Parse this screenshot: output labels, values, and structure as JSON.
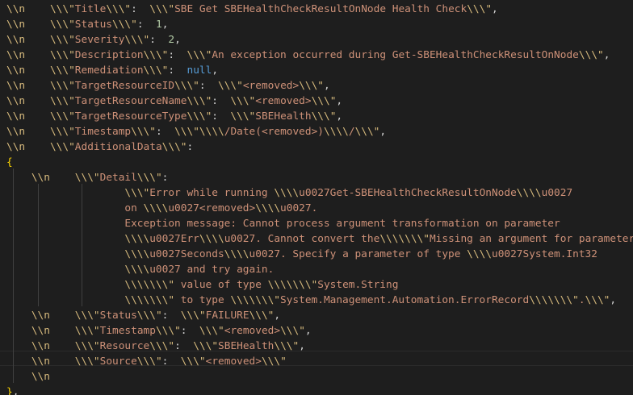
{
  "colors": {
    "background": "#1e1e1e",
    "escape": "#d7ba7d",
    "string": "#ce9178",
    "number": "#b5cea8",
    "keyword": "#569cd6",
    "text": "#d4d4d4",
    "brace": "#ffd700",
    "indent_guide": "#404040"
  },
  "lines": [
    [
      {
        "t": "esc",
        "v": "\\\\n"
      },
      {
        "t": "txt",
        "v": "    "
      },
      {
        "t": "esc",
        "v": "\\\\\\\""
      },
      {
        "t": "str",
        "v": "Title"
      },
      {
        "t": "esc",
        "v": "\\\\\\\""
      },
      {
        "t": "txt",
        "v": ":  "
      },
      {
        "t": "esc",
        "v": "\\\\\\\""
      },
      {
        "t": "str",
        "v": "SBE Get SBEHealthCheckResultOnNode Health Check"
      },
      {
        "t": "esc",
        "v": "\\\\\\\""
      },
      {
        "t": "txt",
        "v": ","
      }
    ],
    [
      {
        "t": "esc",
        "v": "\\\\n"
      },
      {
        "t": "txt",
        "v": "    "
      },
      {
        "t": "esc",
        "v": "\\\\\\\""
      },
      {
        "t": "str",
        "v": "Status"
      },
      {
        "t": "esc",
        "v": "\\\\\\\""
      },
      {
        "t": "txt",
        "v": ":  "
      },
      {
        "t": "num",
        "v": "1"
      },
      {
        "t": "txt",
        "v": ","
      }
    ],
    [
      {
        "t": "esc",
        "v": "\\\\n"
      },
      {
        "t": "txt",
        "v": "    "
      },
      {
        "t": "esc",
        "v": "\\\\\\\""
      },
      {
        "t": "str",
        "v": "Severity"
      },
      {
        "t": "esc",
        "v": "\\\\\\\""
      },
      {
        "t": "txt",
        "v": ":  "
      },
      {
        "t": "num",
        "v": "2"
      },
      {
        "t": "txt",
        "v": ","
      }
    ],
    [
      {
        "t": "esc",
        "v": "\\\\n"
      },
      {
        "t": "txt",
        "v": "    "
      },
      {
        "t": "esc",
        "v": "\\\\\\\""
      },
      {
        "t": "str",
        "v": "Description"
      },
      {
        "t": "esc",
        "v": "\\\\\\\""
      },
      {
        "t": "txt",
        "v": ":  "
      },
      {
        "t": "esc",
        "v": "\\\\\\\""
      },
      {
        "t": "str",
        "v": "An exception occurred during Get-SBEHealthCheckResultOnNode"
      },
      {
        "t": "esc",
        "v": "\\\\\\\""
      },
      {
        "t": "txt",
        "v": ","
      }
    ],
    [
      {
        "t": "esc",
        "v": "\\\\n"
      },
      {
        "t": "txt",
        "v": "    "
      },
      {
        "t": "esc",
        "v": "\\\\\\\""
      },
      {
        "t": "str",
        "v": "Remediation"
      },
      {
        "t": "esc",
        "v": "\\\\\\\""
      },
      {
        "t": "txt",
        "v": ":  "
      },
      {
        "t": "kw",
        "v": "null"
      },
      {
        "t": "txt",
        "v": ","
      }
    ],
    [
      {
        "t": "esc",
        "v": "\\\\n"
      },
      {
        "t": "txt",
        "v": "    "
      },
      {
        "t": "esc",
        "v": "\\\\\\\""
      },
      {
        "t": "str",
        "v": "TargetResourceID"
      },
      {
        "t": "esc",
        "v": "\\\\\\\""
      },
      {
        "t": "txt",
        "v": ":  "
      },
      {
        "t": "esc",
        "v": "\\\\\\\""
      },
      {
        "t": "str",
        "v": "<removed>"
      },
      {
        "t": "esc",
        "v": "\\\\\\\""
      },
      {
        "t": "txt",
        "v": ","
      }
    ],
    [
      {
        "t": "esc",
        "v": "\\\\n"
      },
      {
        "t": "txt",
        "v": "    "
      },
      {
        "t": "esc",
        "v": "\\\\\\\""
      },
      {
        "t": "str",
        "v": "TargetResourceName"
      },
      {
        "t": "esc",
        "v": "\\\\\\\""
      },
      {
        "t": "txt",
        "v": ":  "
      },
      {
        "t": "esc",
        "v": "\\\\\\\""
      },
      {
        "t": "str",
        "v": "<removed>"
      },
      {
        "t": "esc",
        "v": "\\\\\\\""
      },
      {
        "t": "txt",
        "v": ","
      }
    ],
    [
      {
        "t": "esc",
        "v": "\\\\n"
      },
      {
        "t": "txt",
        "v": "    "
      },
      {
        "t": "esc",
        "v": "\\\\\\\""
      },
      {
        "t": "str",
        "v": "TargetResourceType"
      },
      {
        "t": "esc",
        "v": "\\\\\\\""
      },
      {
        "t": "txt",
        "v": ":  "
      },
      {
        "t": "esc",
        "v": "\\\\\\\""
      },
      {
        "t": "str",
        "v": "SBEHealth"
      },
      {
        "t": "esc",
        "v": "\\\\\\\""
      },
      {
        "t": "txt",
        "v": ","
      }
    ],
    [
      {
        "t": "esc",
        "v": "\\\\n"
      },
      {
        "t": "txt",
        "v": "    "
      },
      {
        "t": "esc",
        "v": "\\\\\\\""
      },
      {
        "t": "str",
        "v": "Timestamp"
      },
      {
        "t": "esc",
        "v": "\\\\\\\""
      },
      {
        "t": "txt",
        "v": ":  "
      },
      {
        "t": "esc",
        "v": "\\\\\\\""
      },
      {
        "t": "esc",
        "v": "\\\\\\\\"
      },
      {
        "t": "str",
        "v": "/Date(<removed>)"
      },
      {
        "t": "esc",
        "v": "\\\\\\\\"
      },
      {
        "t": "str",
        "v": "/"
      },
      {
        "t": "esc",
        "v": "\\\\\\\""
      },
      {
        "t": "txt",
        "v": ","
      }
    ],
    [
      {
        "t": "esc",
        "v": "\\\\n"
      },
      {
        "t": "txt",
        "v": "    "
      },
      {
        "t": "esc",
        "v": "\\\\\\\""
      },
      {
        "t": "str",
        "v": "AdditionalData"
      },
      {
        "t": "esc",
        "v": "\\\\\\\""
      },
      {
        "t": "txt",
        "v": ":"
      }
    ],
    [
      {
        "t": "brace",
        "v": "{"
      }
    ],
    [
      {
        "t": "txt",
        "v": "    "
      },
      {
        "t": "esc",
        "v": "\\\\n"
      },
      {
        "t": "txt",
        "v": "    "
      },
      {
        "t": "esc",
        "v": "\\\\\\\""
      },
      {
        "t": "str",
        "v": "Detail"
      },
      {
        "t": "esc",
        "v": "\\\\\\\""
      },
      {
        "t": "txt",
        "v": ":"
      }
    ],
    [
      {
        "t": "txt",
        "v": "                   "
      },
      {
        "t": "esc",
        "v": "\\\\\\\""
      },
      {
        "t": "str",
        "v": "Error while running "
      },
      {
        "t": "esc",
        "v": "\\\\\\\\"
      },
      {
        "t": "str",
        "v": "u0027Get-SBEHealthCheckResultOnNode"
      },
      {
        "t": "esc",
        "v": "\\\\\\\\"
      },
      {
        "t": "str",
        "v": "u0027"
      }
    ],
    [
      {
        "t": "txt",
        "v": "                   "
      },
      {
        "t": "str",
        "v": "on "
      },
      {
        "t": "esc",
        "v": "\\\\\\\\"
      },
      {
        "t": "str",
        "v": "u0027<removed>"
      },
      {
        "t": "esc",
        "v": "\\\\\\\\"
      },
      {
        "t": "str",
        "v": "u0027."
      }
    ],
    [
      {
        "t": "txt",
        "v": "                   "
      },
      {
        "t": "str",
        "v": "Exception message: Cannot process argument transformation on parameter"
      }
    ],
    [
      {
        "t": "txt",
        "v": "                   "
      },
      {
        "t": "esc",
        "v": "\\\\\\\\"
      },
      {
        "t": "str",
        "v": "u0027Err"
      },
      {
        "t": "esc",
        "v": "\\\\\\\\"
      },
      {
        "t": "str",
        "v": "u0027. Cannot convert the"
      },
      {
        "t": "esc",
        "v": "\\\\\\\\\\\\\\\""
      },
      {
        "t": "str",
        "v": "Missing an argument for parameter"
      }
    ],
    [
      {
        "t": "txt",
        "v": "                   "
      },
      {
        "t": "esc",
        "v": "\\\\\\\\"
      },
      {
        "t": "str",
        "v": "u0027Seconds"
      },
      {
        "t": "esc",
        "v": "\\\\\\\\"
      },
      {
        "t": "str",
        "v": "u0027. Specify a parameter of type "
      },
      {
        "t": "esc",
        "v": "\\\\\\\\"
      },
      {
        "t": "str",
        "v": "u0027System.Int32"
      }
    ],
    [
      {
        "t": "txt",
        "v": "                   "
      },
      {
        "t": "esc",
        "v": "\\\\\\\\"
      },
      {
        "t": "str",
        "v": "u0027 and try again."
      }
    ],
    [
      {
        "t": "txt",
        "v": "                   "
      },
      {
        "t": "esc",
        "v": "\\\\\\\\\\\\\\\""
      },
      {
        "t": "str",
        "v": " value of type "
      },
      {
        "t": "esc",
        "v": "\\\\\\\\\\\\\\\""
      },
      {
        "t": "str",
        "v": "System.String"
      }
    ],
    [
      {
        "t": "txt",
        "v": "                   "
      },
      {
        "t": "esc",
        "v": "\\\\\\\\\\\\\\\""
      },
      {
        "t": "str",
        "v": " to type "
      },
      {
        "t": "esc",
        "v": "\\\\\\\\\\\\\\\""
      },
      {
        "t": "str",
        "v": "System.Management.Automation.ErrorRecord"
      },
      {
        "t": "esc",
        "v": "\\\\\\\\\\\\\\\""
      },
      {
        "t": "str",
        "v": "."
      },
      {
        "t": "esc",
        "v": "\\\\\\\""
      },
      {
        "t": "txt",
        "v": ","
      }
    ],
    [
      {
        "t": "txt",
        "v": "    "
      },
      {
        "t": "esc",
        "v": "\\\\n"
      },
      {
        "t": "txt",
        "v": "    "
      },
      {
        "t": "esc",
        "v": "\\\\\\\""
      },
      {
        "t": "str",
        "v": "Status"
      },
      {
        "t": "esc",
        "v": "\\\\\\\""
      },
      {
        "t": "txt",
        "v": ":  "
      },
      {
        "t": "esc",
        "v": "\\\\\\\""
      },
      {
        "t": "str",
        "v": "FAILURE"
      },
      {
        "t": "esc",
        "v": "\\\\\\\""
      },
      {
        "t": "txt",
        "v": ","
      }
    ],
    [
      {
        "t": "txt",
        "v": "    "
      },
      {
        "t": "esc",
        "v": "\\\\n"
      },
      {
        "t": "txt",
        "v": "    "
      },
      {
        "t": "esc",
        "v": "\\\\\\\""
      },
      {
        "t": "str",
        "v": "Timestamp"
      },
      {
        "t": "esc",
        "v": "\\\\\\\""
      },
      {
        "t": "txt",
        "v": ":  "
      },
      {
        "t": "esc",
        "v": "\\\\\\\""
      },
      {
        "t": "str",
        "v": "<removed>"
      },
      {
        "t": "esc",
        "v": "\\\\\\\""
      },
      {
        "t": "txt",
        "v": ","
      }
    ],
    [
      {
        "t": "txt",
        "v": "    "
      },
      {
        "t": "esc",
        "v": "\\\\n"
      },
      {
        "t": "txt",
        "v": "    "
      },
      {
        "t": "esc",
        "v": "\\\\\\\""
      },
      {
        "t": "str",
        "v": "Resource"
      },
      {
        "t": "esc",
        "v": "\\\\\\\""
      },
      {
        "t": "txt",
        "v": ":  "
      },
      {
        "t": "esc",
        "v": "\\\\\\\""
      },
      {
        "t": "str",
        "v": "SBEHealth"
      },
      {
        "t": "esc",
        "v": "\\\\\\\""
      },
      {
        "t": "txt",
        "v": ","
      }
    ],
    [
      {
        "t": "txt",
        "v": "    "
      },
      {
        "t": "esc",
        "v": "\\\\n"
      },
      {
        "t": "txt",
        "v": "    "
      },
      {
        "t": "esc",
        "v": "\\\\\\\""
      },
      {
        "t": "str",
        "v": "Source"
      },
      {
        "t": "esc",
        "v": "\\\\\\\""
      },
      {
        "t": "txt",
        "v": ":  "
      },
      {
        "t": "esc",
        "v": "\\\\\\\""
      },
      {
        "t": "str",
        "v": "<removed>"
      },
      {
        "t": "esc",
        "v": "\\\\\\\""
      }
    ],
    [
      {
        "t": "txt",
        "v": "    "
      },
      {
        "t": "esc",
        "v": "\\\\n"
      }
    ],
    [
      {
        "t": "brace",
        "v": "}"
      },
      {
        "t": "txt",
        "v": ","
      }
    ]
  ]
}
